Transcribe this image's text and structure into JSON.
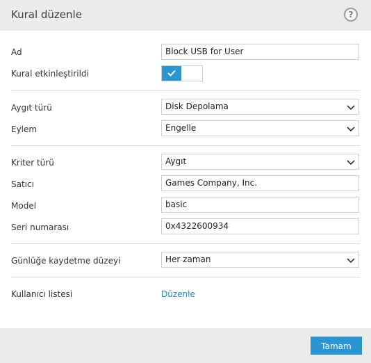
{
  "dialog": {
    "title": "Kural düzenle",
    "help_glyph": "?"
  },
  "fields": {
    "name": {
      "label": "Ad",
      "value": "Block USB for User"
    },
    "enabled": {
      "label": "Kural etkinleştirildi",
      "state": true
    },
    "device_type": {
      "label": "Aygıt türü",
      "value": "Disk Depolama"
    },
    "action": {
      "label": "Eylem",
      "value": "Engelle"
    },
    "criteria_type": {
      "label": "Kriter türü",
      "value": "Aygıt"
    },
    "vendor": {
      "label": "Satıcı",
      "value": "Games Company, Inc."
    },
    "model": {
      "label": "Model",
      "value": "basic"
    },
    "serial": {
      "label": "Seri numarası",
      "value": "0x4322600934"
    },
    "log_level": {
      "label": "Günlüğe kaydetme düzeyi",
      "value": "Her zaman"
    },
    "user_list": {
      "label": "Kullanıcı listesi",
      "link": "Düzenle"
    }
  },
  "footer": {
    "ok_label": "Tamam"
  },
  "colors": {
    "accent": "#2a95d0",
    "link": "#1f8bc7",
    "header_bg": "#ebebeb"
  }
}
